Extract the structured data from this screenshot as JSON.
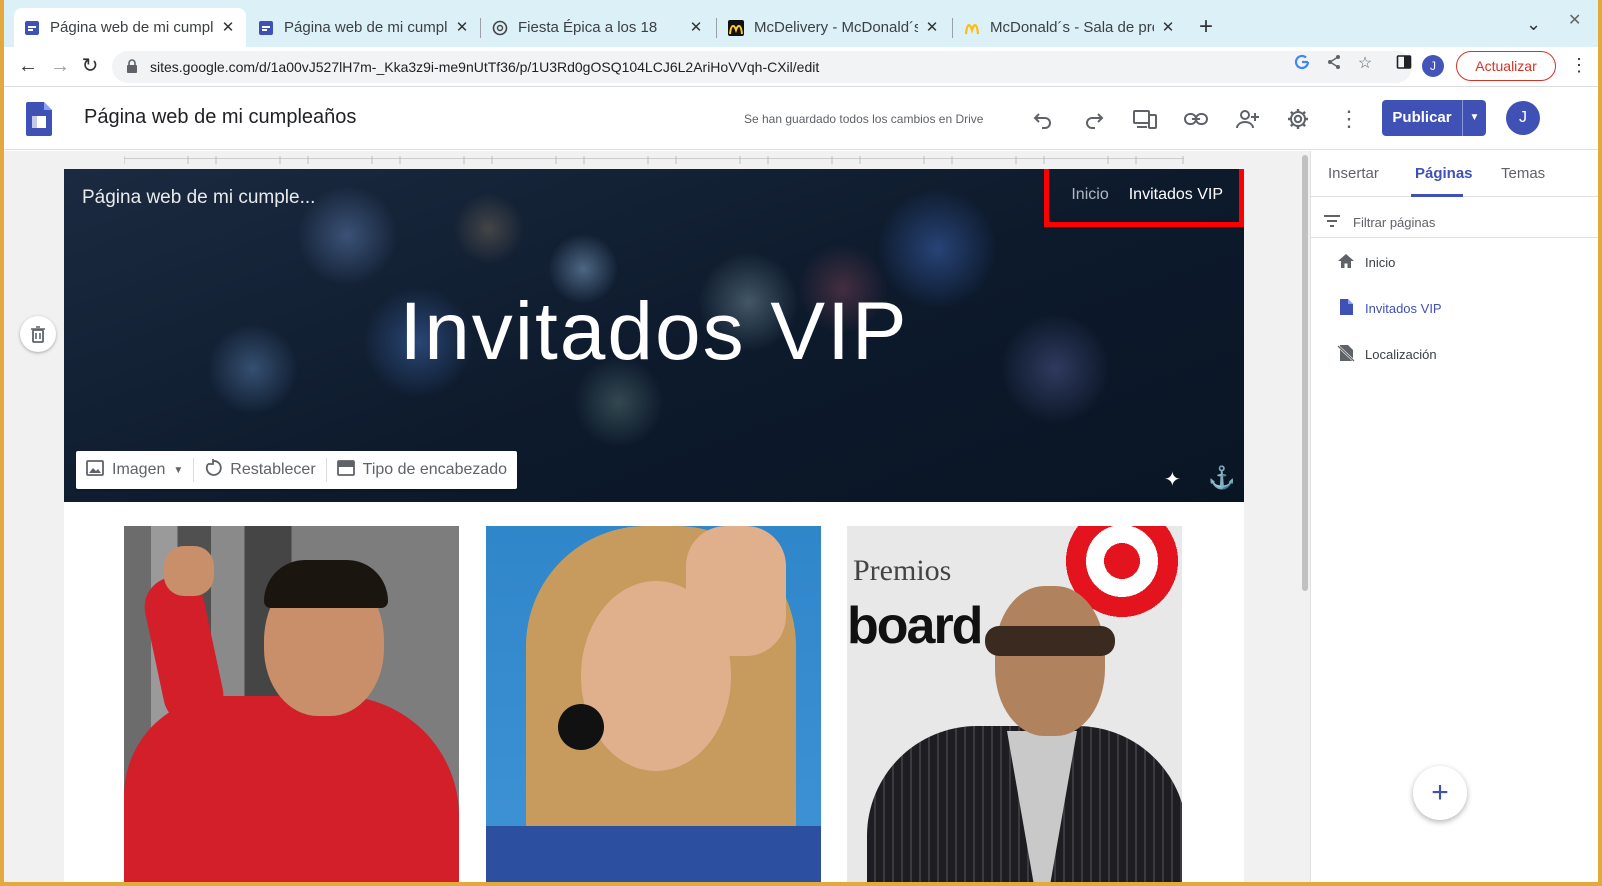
{
  "browser": {
    "tabs": [
      {
        "title": "Página web de mi cumpleaños",
        "active": true,
        "icon": "google-sites-icon"
      },
      {
        "title": "Página web de mi cumpleaños",
        "active": false,
        "icon": "google-sites-icon"
      },
      {
        "title": "Fiesta Épica a los 18",
        "active": false,
        "icon": "chatgpt-icon"
      },
      {
        "title": "McDelivery - McDonald´s",
        "active": false,
        "icon": "mcdonalds-icon"
      },
      {
        "title": "McDonald´s - Sala de prensa",
        "active": false,
        "icon": "mcdonalds-icon"
      }
    ],
    "url": "sites.google.com/d/1a00vJ527lH7m-_Kka3z9i-me9nUtTf36/p/1U3Rd0gOSQ104LCJ6L2AriHoVVqh-CXil/edit",
    "profile_initial": "J",
    "update_label": "Actualizar"
  },
  "app": {
    "title": "Página web de mi cumpleaños",
    "saved_status": "Se han guardado todos los cambios en Drive",
    "publish_label": "Publicar",
    "avatar_initial": "J",
    "accent": "#3f51b5"
  },
  "page": {
    "site_title": "Página web de mi cumple...",
    "nav": [
      "Inicio",
      "Invitados VIP"
    ],
    "heading": "Invitados VIP",
    "header_tools": {
      "image": "Imagen",
      "reset": "Restablecer",
      "header_type": "Tipo de encabezado"
    },
    "highlight_color": "#ff0000"
  },
  "panel": {
    "tabs": [
      "Insertar",
      "Páginas",
      "Temas"
    ],
    "active_tab": "Páginas",
    "filter_placeholder": "Filtrar páginas",
    "pages": [
      {
        "label": "Inicio",
        "icon": "home-icon",
        "selected": false
      },
      {
        "label": "Invitados VIP",
        "icon": "page-icon",
        "selected": true
      },
      {
        "label": "Localización",
        "icon": "hidden-page-icon",
        "selected": false
      }
    ]
  }
}
